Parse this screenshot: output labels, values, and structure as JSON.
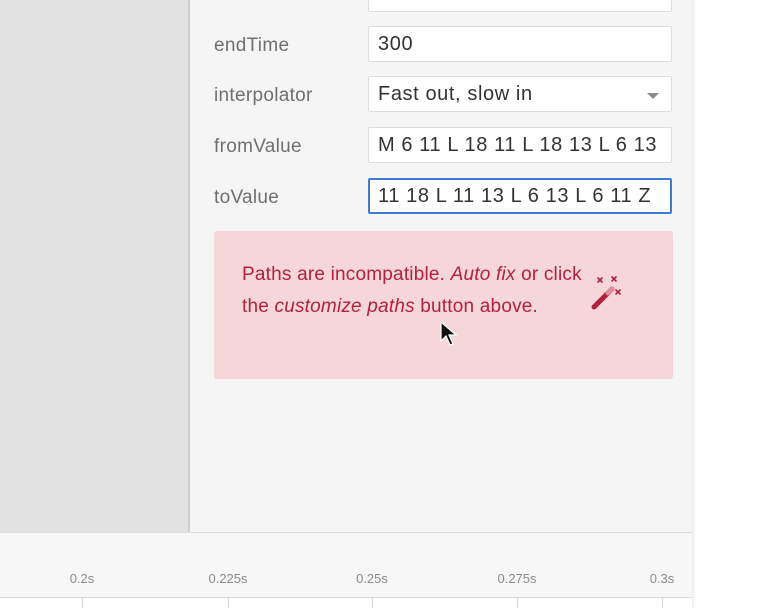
{
  "properties": {
    "endTime": {
      "label": "endTime",
      "value": "300"
    },
    "interpolator": {
      "label": "interpolator",
      "value": "Fast out, slow in"
    },
    "fromValue": {
      "label": "fromValue",
      "value": "M 6 11 L 18 11 L 18 13 L 6 13"
    },
    "toValue": {
      "label": "toValue",
      "value": "11 18 L 11 13 L 6 13 L 6 11 Z"
    }
  },
  "error": {
    "prefix": "Paths are incompatible. ",
    "autofix_link": "Auto fix",
    "middle": " or click the ",
    "customize_text": "customize paths",
    "suffix": " button above.",
    "icon": "magic-wand-icon",
    "color": "#b4203d",
    "background": "#f5d7da"
  },
  "timeline": {
    "ticks": [
      "0.2s",
      "0.225s",
      "0.25s",
      "0.275s",
      "0.3s"
    ]
  },
  "colors": {
    "focus_border": "#3f7ad8",
    "panel_bg": "#f5f5f5",
    "canvas_bg": "#e2e2e2"
  }
}
